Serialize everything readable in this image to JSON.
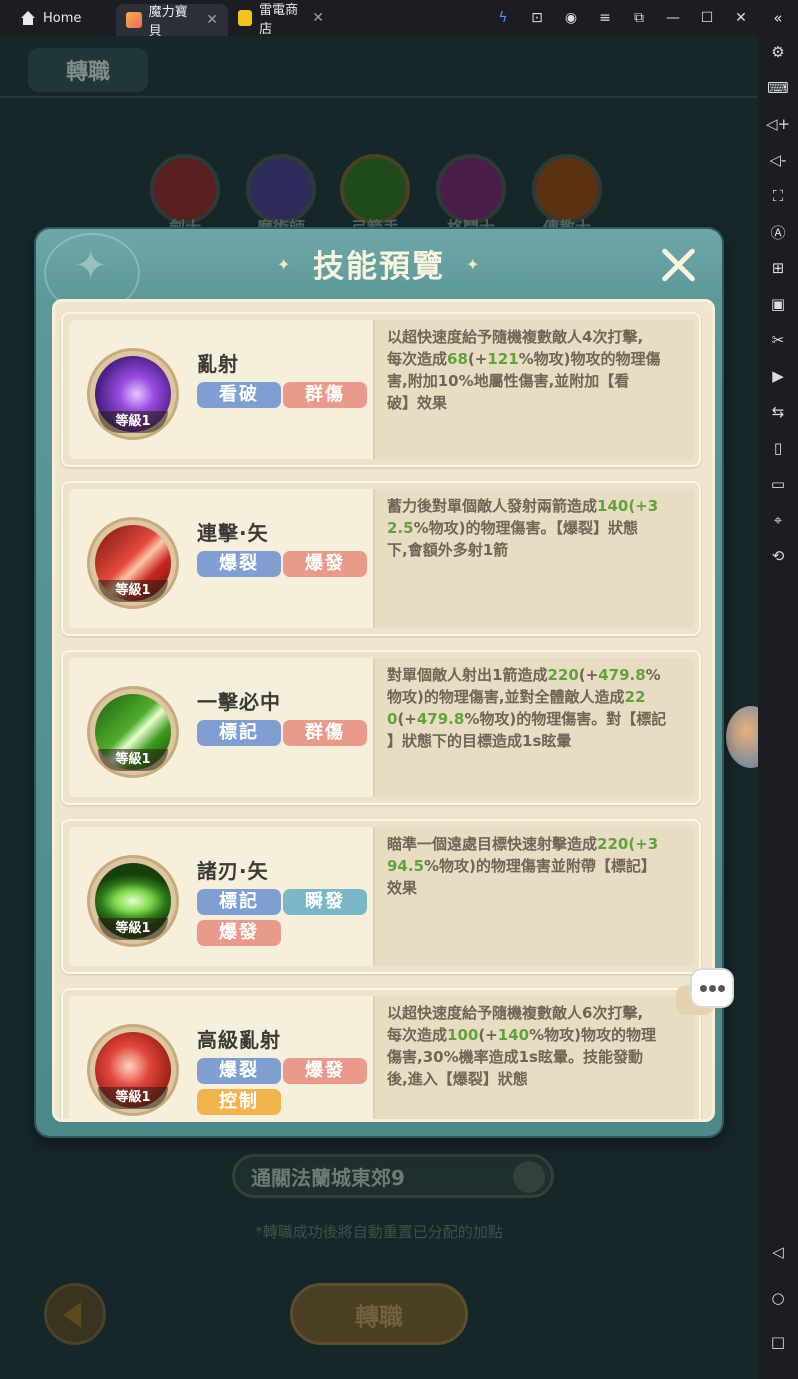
{
  "tabs": {
    "home": "Home",
    "game": "魔力寶貝",
    "store": "雷電商店"
  },
  "background": {
    "title": "轉職",
    "classes": [
      "劍士",
      "魔術師",
      "弓箭手",
      "格鬥士",
      "傳教士"
    ],
    "stage": "通關法蘭城東郊9",
    "note": "*轉職成功後將自動重置已分配的加點",
    "confirm": "轉職"
  },
  "modal": {
    "title": "技能預覽"
  },
  "skills": [
    {
      "name": "亂射",
      "level": "等級1",
      "tags": [
        "看破",
        "群傷"
      ],
      "desc": [
        "以超快速度給予隨機複數敵人4次打擊,",
        "每次造成",
        "68",
        "(+",
        "121",
        "%物攻)物攻的物理傷",
        "害,附加10%地屬性傷害,並附加【看",
        "破】效果"
      ]
    },
    {
      "name": "連擊·矢",
      "level": "等級1",
      "tags": [
        "爆裂",
        "爆發"
      ],
      "desc": [
        "蓄力後對單個敵人發射兩箭造成",
        "140",
        "(+3",
        "2.5",
        "%物攻)的物理傷害。【爆裂】狀態",
        "下,會額外多射1箭"
      ]
    },
    {
      "name": "一擊必中",
      "level": "等級1",
      "tags": [
        "標記",
        "群傷"
      ],
      "desc": [
        "對單個敵人射出1箭造成",
        "220",
        "(+",
        "479.8",
        "%",
        "物攻)的物理傷害,並對全體敵人造成",
        "22",
        "0",
        "(+",
        "479.8",
        "%物攻)的物理傷害。對【標記",
        "】狀態下的目標造成1s眩暈"
      ]
    },
    {
      "name": "諸刃·矢",
      "level": "等級1",
      "tags": [
        "標記",
        "瞬發",
        "爆發"
      ],
      "desc": [
        "瞄準一個遠處目標快速射擊造成",
        "220",
        "(+3",
        "94.5",
        "%物攻)的物理傷害並附帶【標記】",
        "效果"
      ]
    },
    {
      "name": "高級亂射",
      "level": "等級1",
      "tags": [
        "爆裂",
        "爆發",
        "控制"
      ],
      "desc": [
        "以超快速度給予隨機複數敵人6次打擊,",
        "每次造成",
        "100",
        "(+",
        "140",
        "%物攻)物攻的物理",
        "傷害,30%機率造成1s眩暈。技能發動",
        "後,進入【爆裂】狀態"
      ]
    }
  ]
}
